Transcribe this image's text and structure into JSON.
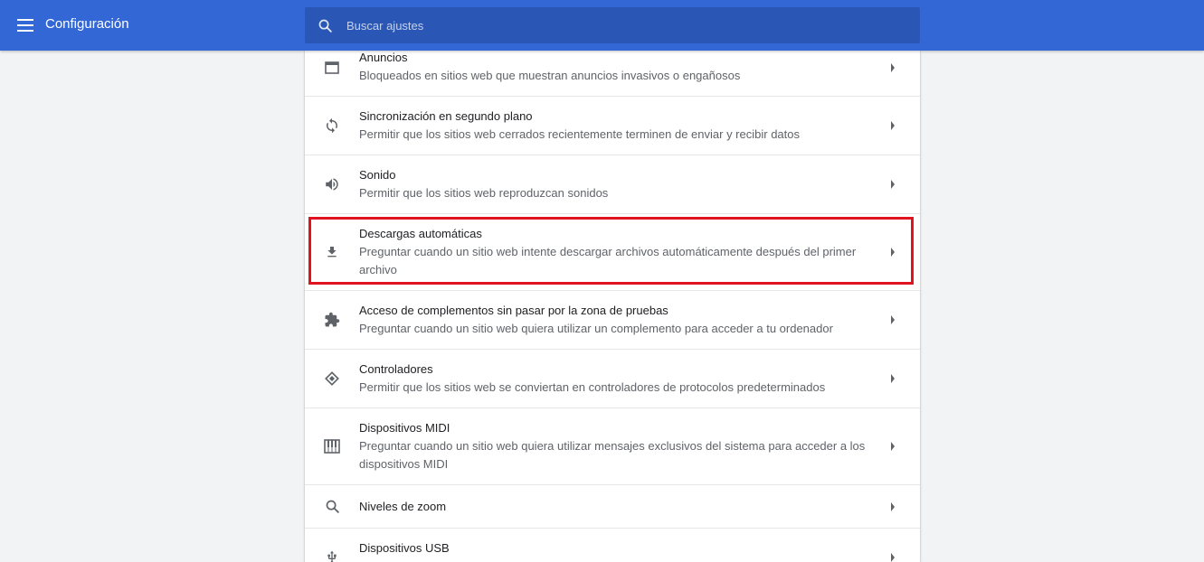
{
  "header": {
    "title": "Configuración",
    "menu_icon": "hamburger-menu-icon",
    "search": {
      "placeholder": "Buscar ajustes",
      "value": "",
      "icon": "search-icon"
    },
    "accent_color": "#3367d6"
  },
  "settings": {
    "items": [
      {
        "title": "Anuncios",
        "description": "Bloqueados en sitios web que muestran anuncios invasivos o engañosos",
        "icon": "ads-window-icon"
      },
      {
        "title": "Sincronización en segundo plano",
        "description": "Permitir que los sitios web cerrados recientemente terminen de enviar y recibir datos",
        "icon": "sync-icon"
      },
      {
        "title": "Sonido",
        "description": "Permitir que los sitios web reproduzcan sonidos",
        "icon": "volume-icon"
      },
      {
        "title": "Descargas automáticas",
        "description": "Preguntar cuando un sitio web intente descargar archivos automáticamente después del primer archivo",
        "icon": "download-icon",
        "highlighted": true
      },
      {
        "title": "Acceso de complementos sin pasar por la zona de pruebas",
        "description": "Preguntar cuando un sitio web quiera utilizar un complemento para acceder a tu ordenador",
        "icon": "puzzle-icon"
      },
      {
        "title": "Controladores",
        "description": "Permitir que los sitios web se conviertan en controladores de protocolos predeterminados",
        "icon": "handler-diamond-icon"
      },
      {
        "title": "Dispositivos MIDI",
        "description": "Preguntar cuando un sitio web quiera utilizar mensajes exclusivos del sistema para acceder a los dispositivos MIDI",
        "icon": "piano-icon"
      },
      {
        "title": "Niveles de zoom",
        "description": "",
        "icon": "zoom-icon"
      },
      {
        "title": "Dispositivos USB",
        "description": "",
        "icon": "usb-icon"
      }
    ],
    "highlight_color": "#e0131e"
  }
}
